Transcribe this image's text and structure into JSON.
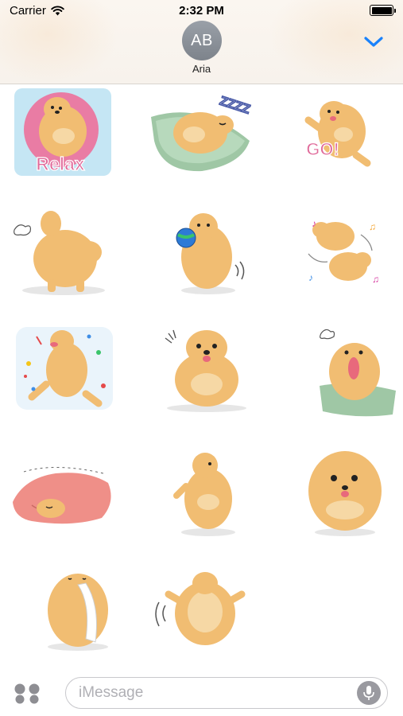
{
  "status_bar": {
    "carrier": "Carrier",
    "time": "2:32 PM",
    "battery_level": 1.0
  },
  "header": {
    "avatar_initials": "AB",
    "contact_name": "Aria",
    "collapse_icon": "chevron-down-icon",
    "accent_color": "#1a82fb"
  },
  "stickers": {
    "relax_caption": "Relax",
    "sleep_caption": "ZZZZ",
    "go_caption": "GO!",
    "count": 14
  },
  "input_bar": {
    "placeholder": "iMessage",
    "apps_icon": "app-drawer-icon",
    "mic_icon": "microphone-icon"
  }
}
